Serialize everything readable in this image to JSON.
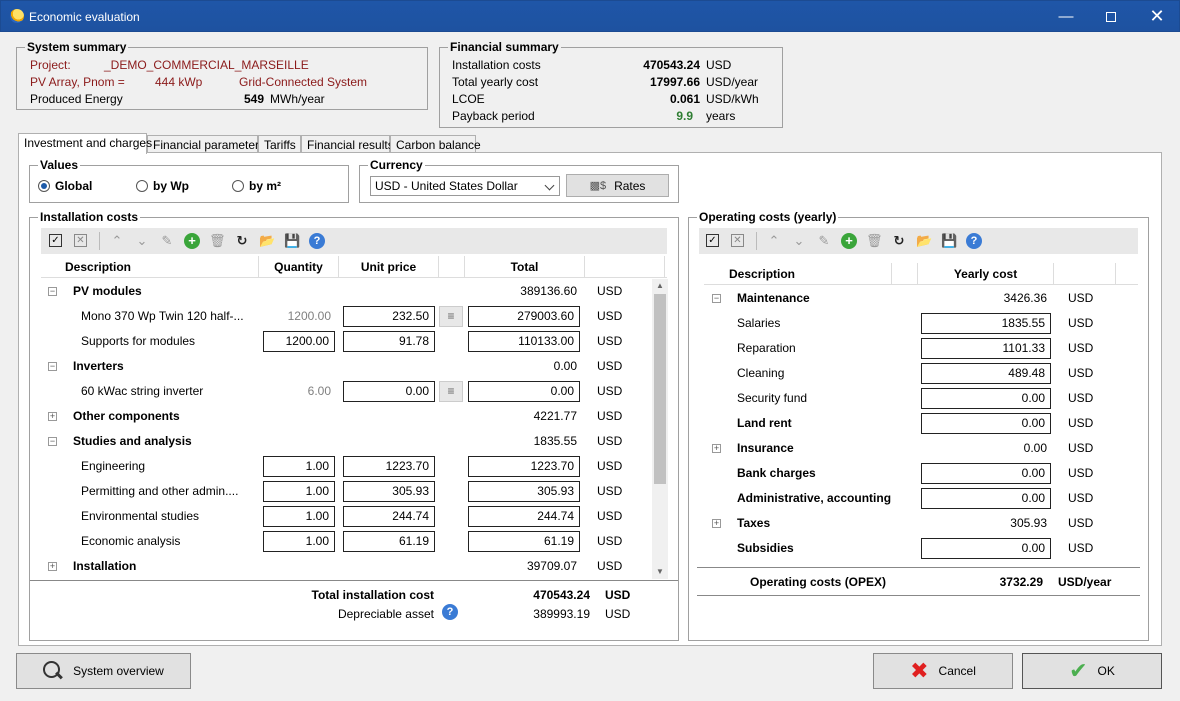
{
  "window": {
    "title": "Economic evaluation"
  },
  "system_summary": {
    "label": "System summary",
    "project_label": "Project:",
    "project_value": "_DEMO_COMMERCIAL_MARSEILLE",
    "pv_label": "PV Array, Pnom =",
    "pv_value": "444 kWp",
    "grid": "Grid-Connected System",
    "energy_label": "Produced Energy",
    "energy_value": "549",
    "energy_unit": "MWh/year"
  },
  "financial_summary": {
    "label": "Financial summary",
    "rows": [
      {
        "label": "Installation costs",
        "value": "470543.24",
        "unit": "USD"
      },
      {
        "label": "Total yearly cost",
        "value": "17997.66",
        "unit": "USD/year"
      },
      {
        "label": "LCOE",
        "value": "0.061",
        "unit": "USD/kWh"
      },
      {
        "label": "Payback period",
        "value": "9.9",
        "unit": "years"
      }
    ]
  },
  "tabs": [
    "Investment and charges",
    "Financial parameters",
    "Tariffs",
    "Financial results",
    "Carbon balance"
  ],
  "values_box": {
    "label": "Values",
    "options": [
      "Global",
      "by Wp",
      "by m²"
    ],
    "selected": 0
  },
  "currency_box": {
    "label": "Currency",
    "selected": "USD - United States Dollar",
    "rates_label": "Rates"
  },
  "installation": {
    "label": "Installation costs",
    "headers": {
      "description": "Description",
      "quantity": "Quantity",
      "unit_price": "Unit price",
      "total": "Total"
    },
    "rows": [
      {
        "type": "group",
        "expanded": true,
        "desc": "PV modules",
        "total": "389136.60",
        "unit": "USD"
      },
      {
        "type": "item",
        "desc": "Mono 370 Wp Twin 120 half-...",
        "qty": "1200.00",
        "qty_editable": false,
        "price": "232.50",
        "db": true,
        "total": "279003.60",
        "unit": "USD"
      },
      {
        "type": "item",
        "desc": "Supports for modules",
        "qty": "1200.00",
        "qty_editable": true,
        "price": "91.78",
        "db": false,
        "total": "110133.00",
        "unit": "USD"
      },
      {
        "type": "group",
        "expanded": true,
        "desc": "Inverters",
        "total": "0.00",
        "unit": "USD"
      },
      {
        "type": "item",
        "desc": "60 kWac string inverter",
        "qty": "6.00",
        "qty_editable": false,
        "price": "0.00",
        "db": true,
        "total": "0.00",
        "unit": "USD"
      },
      {
        "type": "group",
        "expanded": false,
        "desc": "Other components",
        "total": "4221.77",
        "unit": "USD"
      },
      {
        "type": "group",
        "expanded": true,
        "desc": "Studies and analysis",
        "total": "1835.55",
        "unit": "USD"
      },
      {
        "type": "item",
        "desc": "Engineering",
        "qty": "1.00",
        "qty_editable": true,
        "price": "1223.70",
        "db": false,
        "total": "1223.70",
        "unit": "USD"
      },
      {
        "type": "item",
        "desc": "Permitting and other admin....",
        "qty": "1.00",
        "qty_editable": true,
        "price": "305.93",
        "db": false,
        "total": "305.93",
        "unit": "USD"
      },
      {
        "type": "item",
        "desc": "Environmental studies",
        "qty": "1.00",
        "qty_editable": true,
        "price": "244.74",
        "db": false,
        "total": "244.74",
        "unit": "USD"
      },
      {
        "type": "item",
        "desc": "Economic analysis",
        "qty": "1.00",
        "qty_editable": true,
        "price": "61.19",
        "db": false,
        "total": "61.19",
        "unit": "USD"
      },
      {
        "type": "group",
        "expanded": false,
        "desc": "Installation",
        "total": "39709.07",
        "unit": "USD"
      }
    ],
    "total_label": "Total installation cost",
    "total_value": "470543.24",
    "total_unit": "USD",
    "depreciable_label": "Depreciable asset",
    "depreciable_value": "389993.19",
    "depreciable_unit": "USD"
  },
  "operating": {
    "label": "Operating costs (yearly)",
    "headers": {
      "description": "Description",
      "yearly": "Yearly cost"
    },
    "rows": [
      {
        "type": "group",
        "expanded": true,
        "desc": "Maintenance",
        "value": "3426.36",
        "editable": false,
        "unit": "USD"
      },
      {
        "type": "item",
        "desc": "Salaries",
        "value": "1835.55",
        "editable": true,
        "unit": "USD"
      },
      {
        "type": "item",
        "desc": "Reparation",
        "value": "1101.33",
        "editable": true,
        "unit": "USD"
      },
      {
        "type": "item",
        "desc": "Cleaning",
        "value": "489.48",
        "editable": true,
        "unit": "USD"
      },
      {
        "type": "item",
        "desc": "Security fund",
        "value": "0.00",
        "editable": true,
        "unit": "USD"
      },
      {
        "type": "top",
        "desc": "Land rent",
        "value": "0.00",
        "editable": true,
        "unit": "USD"
      },
      {
        "type": "group",
        "expanded": false,
        "desc": "Insurance",
        "value": "0.00",
        "editable": false,
        "unit": "USD"
      },
      {
        "type": "top",
        "desc": "Bank charges",
        "value": "0.00",
        "editable": true,
        "unit": "USD"
      },
      {
        "type": "top",
        "desc": "Administrative, accounting",
        "value": "0.00",
        "editable": true,
        "unit": "USD"
      },
      {
        "type": "group",
        "expanded": false,
        "desc": "Taxes",
        "value": "305.93",
        "editable": false,
        "unit": "USD"
      },
      {
        "type": "top",
        "desc": "Subsidies",
        "value": "0.00",
        "editable": true,
        "unit": "USD"
      }
    ],
    "total_label": "Operating costs (OPEX)",
    "total_value": "3732.29",
    "total_unit": "USD/year"
  },
  "buttons": {
    "overview": "System overview",
    "cancel": "Cancel",
    "ok": "OK"
  }
}
